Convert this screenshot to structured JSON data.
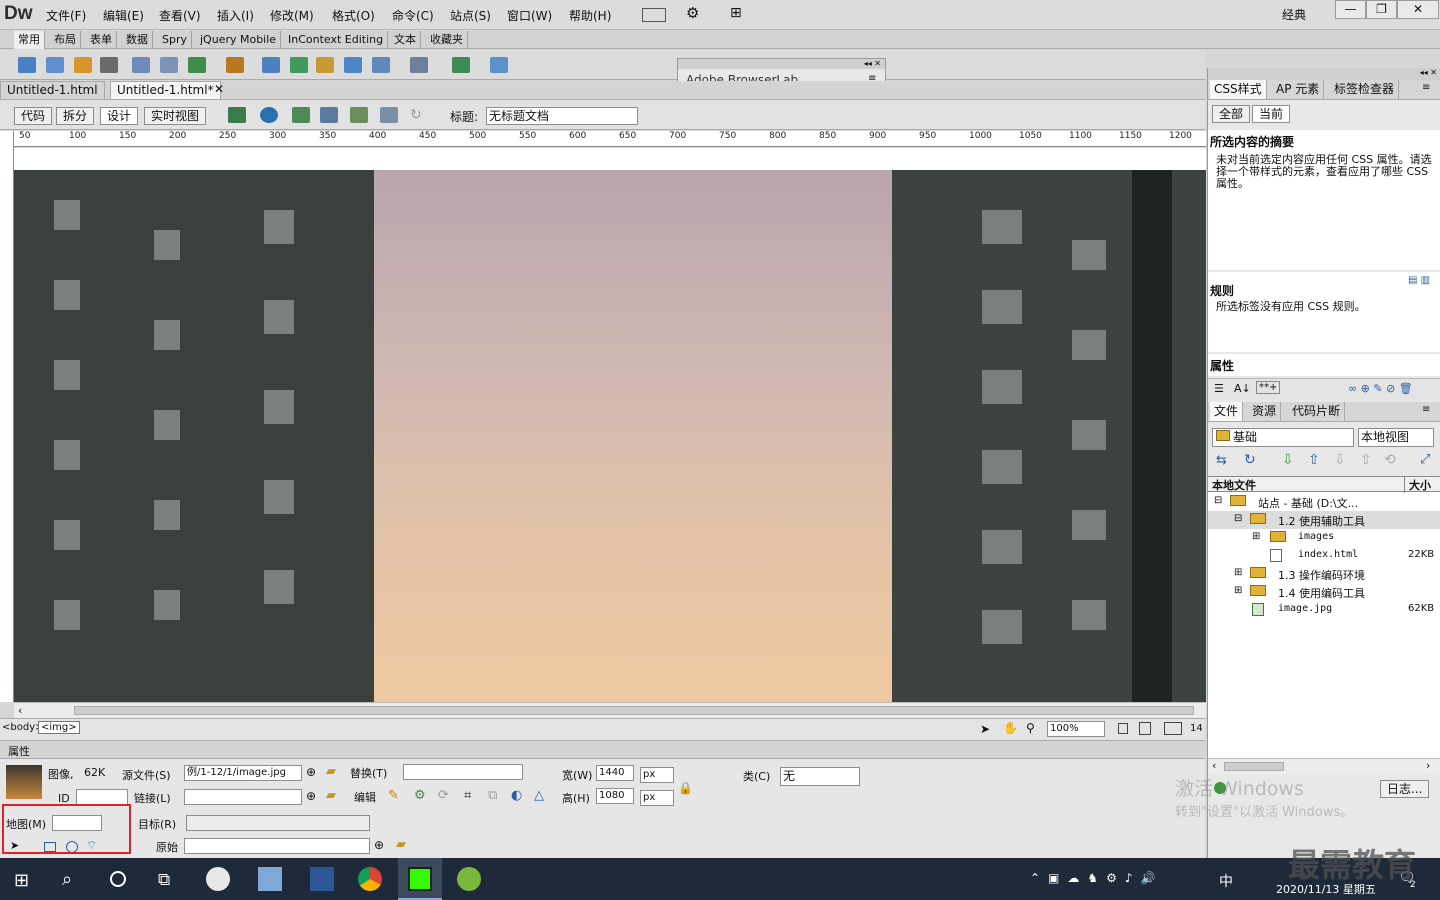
{
  "app": {
    "logo": "Dw",
    "menus": [
      "文件(F)",
      "编辑(E)",
      "查看(V)",
      "插入(I)",
      "修改(M)",
      "格式(O)",
      "命令(C)",
      "站点(S)",
      "窗口(W)",
      "帮助(H)"
    ],
    "workspace": "经典",
    "win_min": "—",
    "win_max": "❐",
    "win_close": "✕"
  },
  "insert_tabs": [
    "常用",
    "布局",
    "表单",
    "数据",
    "Spry",
    "jQuery Mobile",
    "InContext Editing",
    "文本",
    "收藏夹"
  ],
  "doc_tabs": [
    "Untitled-1.html",
    "Untitled-1.html*"
  ],
  "doc_toolbar": {
    "views": [
      "代码",
      "拆分",
      "设计",
      "实时视图"
    ],
    "title_label": "标题:",
    "title_value": "无标题文档"
  },
  "floating_panel": {
    "title": "Adobe BrowserLab"
  },
  "ruler": {
    "labels": [
      "50",
      "100",
      "150",
      "200",
      "250",
      "300",
      "350",
      "400",
      "450",
      "500",
      "550",
      "600",
      "650",
      "700",
      "750",
      "800",
      "850",
      "900",
      "950",
      "1000",
      "1050",
      "1100",
      "1150",
      "1200"
    ]
  },
  "status": {
    "tag_body": "<body>",
    "tag_img": "<img>",
    "zoom": "100%",
    "width_readout": "14"
  },
  "properties": {
    "header": "属性",
    "image_label": "图像,",
    "image_size": "62K",
    "id_label": "ID",
    "src_label": "源文件(S)",
    "src_value": "例/1-12/1/image.jpg",
    "link_label": "链接(L)",
    "alt_label": "替换(T)",
    "edit_label": "编辑",
    "width_label": "宽(W)",
    "width_value": "1440",
    "height_label": "高(H)",
    "height_value": "1080",
    "unit": "px",
    "class_label": "类(C)",
    "class_value": "无",
    "map_label": "地图(M)",
    "target_label": "目标(R)",
    "original_label": "原始"
  },
  "right_panel": {
    "top_tabs": [
      "CSS样式",
      "AP 元素",
      "标签检查器"
    ],
    "mode_tabs": [
      "全部",
      "当前"
    ],
    "summary_title": "所选内容的摘要",
    "summary_text": "未对当前选定内容应用任何 CSS 属性。请选择一个带样式的元素，查看应用了哪些 CSS 属性。",
    "rules_title": "规则",
    "rules_text": "所选标签没有应用 CSS 规则。",
    "props_title": "属性",
    "file_tabs": [
      "文件",
      "资源",
      "代码片断"
    ],
    "site_select": "基础",
    "view_select": "本地视图",
    "col_local": "本地文件",
    "col_size": "大小",
    "tree": [
      {
        "name": "站点 - 基础 (D:\\文...",
        "size": "",
        "level": 0,
        "kind": "site"
      },
      {
        "name": "1.2 使用辅助工具",
        "size": "",
        "level": 1,
        "kind": "folder"
      },
      {
        "name": "images",
        "size": "",
        "level": 2,
        "kind": "folder"
      },
      {
        "name": "index.html",
        "size": "22KB",
        "level": 2,
        "kind": "file"
      },
      {
        "name": "1.3 操作编码环境",
        "size": "",
        "level": 1,
        "kind": "folder"
      },
      {
        "name": "1.4 使用编码工具",
        "size": "",
        "level": 1,
        "kind": "folder"
      },
      {
        "name": "image.jpg",
        "size": "62KB",
        "level": 1,
        "kind": "image"
      }
    ],
    "log_button": "日志..."
  },
  "watermark": {
    "line1": "激活 Windows",
    "line2": "转到\"设置\"以激活 Windows。",
    "brand": "最需教育"
  },
  "taskbar": {
    "ime": "中",
    "date": "2020/11/13 星期五",
    "notif_count": "2"
  }
}
